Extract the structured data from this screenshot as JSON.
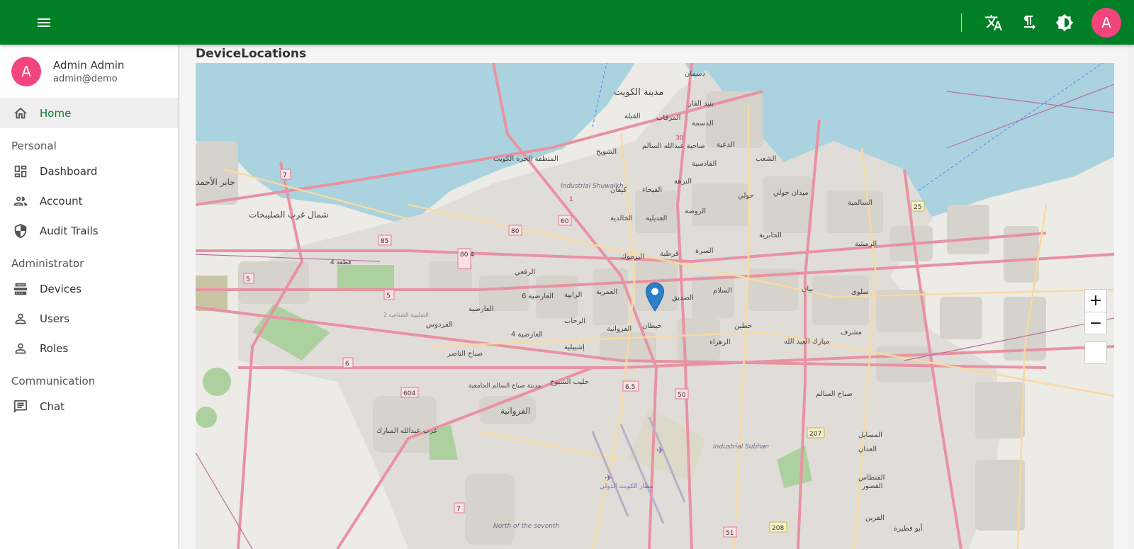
{
  "header": {
    "menu_icon": "hamburger-icon",
    "icons": [
      "translate-icon",
      "text-direction-icon",
      "brightness-icon"
    ],
    "avatar_letter": "A",
    "accent_color": "#017f26",
    "avatar_color": "#f2457e"
  },
  "profile": {
    "avatar_letter": "A",
    "name": "Admin Admin",
    "email": "admin@demo"
  },
  "nav": {
    "home": "Home",
    "personal_title": "Personal",
    "dashboard": "Dashboard",
    "account": "Account",
    "audit_trails": "Audit Trails",
    "administrator_title": "Administrator",
    "devices": "Devices",
    "users": "Users",
    "roles": "Roles",
    "communication_title": "Communication",
    "chat": "Chat"
  },
  "page": {
    "title": "DeviceLocations"
  },
  "map": {
    "zoom_in": "+",
    "zoom_out": "−",
    "labels": [
      "مدينة الكويت",
      "دسمان",
      "القبلة",
      "المرقاب",
      "الدسمة",
      "بنيد القار",
      "الدعية",
      "صاحية عبدالله السالم",
      "الشويخ",
      "القادسية",
      "الشعب",
      "المنطقة الحرة الكويت",
      "كيفان",
      "الفيحاء",
      "النزهة",
      "حولي",
      "ميدان حولي",
      "السالمية",
      "الخالدية",
      "العديلية",
      "الروضة",
      "الجابرية",
      "شمال غرب الصليبخات",
      "جابر الأحمد",
      "قطعة 4",
      "الرقعي",
      "اليرموك",
      "قرطبة",
      "السرة",
      "الرميثية",
      "العارضية 6",
      "الرابية",
      "العمرية",
      "الصديق",
      "السلام",
      "بيان",
      "سلوى",
      "العارضية",
      "الفردوس",
      "الرحاب",
      "الفروانية",
      "خيطان",
      "حطين",
      "مشرف",
      "العارضية 4",
      "إشبيلية",
      "الزهراء",
      "مبارك العبد الله",
      "صباح الناصر",
      "حطين",
      "صباح السالم",
      "حليب الشيوخ",
      "مدينة صباح السالم الجامعية",
      "الفروانية",
      "غرب عبدالله المبارك",
      "مطار الكويت الدولي",
      "المسايل",
      "العدان",
      "القصور",
      "الفنطاس",
      "القرين",
      "أبو فطيرة",
      "Industrial Shuwaikh",
      "Industrial Subhan",
      "North of the seventh",
      "الصليبية الصناعية 2"
    ],
    "road_numbers": [
      "7",
      "85",
      "80",
      "60",
      "80 4",
      "5",
      "5",
      "6",
      "604",
      "6.5",
      "50",
      "207",
      "208",
      "51",
      "7",
      "25",
      "1",
      "30"
    ]
  }
}
